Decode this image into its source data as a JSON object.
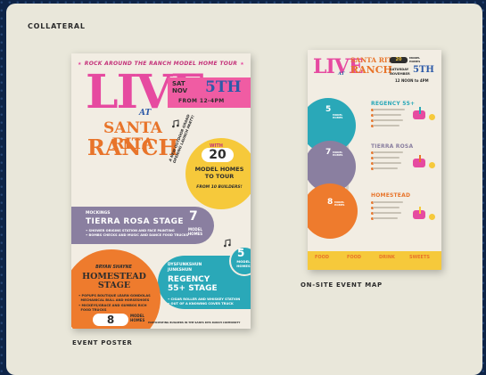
{
  "section_title": "COLLATERAL",
  "poster_caption": "EVENT POSTER",
  "map_caption": "ON-SITE EVENT MAP",
  "poster": {
    "tour_line": "ROCK AROUND THE RANCH MODEL HOME TOUR",
    "live": "LIVE",
    "at": "AT",
    "santa_rita": "SANTA RITA",
    "ranch": "RANCH",
    "sat_nov": "SAT\nNOV",
    "day": "5TH",
    "time": "FROM 12-4PM",
    "vertical_text": "A NEW OUTDOOR GRAND OPENING LAUNCH PARTY!",
    "with": "WITH",
    "model_count": "20",
    "model_homes_line": "MODEL HOMES\nTO TOUR",
    "builders": "FROM 10 BUILDERS!",
    "tierra_rosa_small": "MOCKINGS",
    "tierra_rosa_stage": "TIERRA ROSA STAGE",
    "tierra_rosa_list": "• SHOWER ORIGINS STATION AND FACE PAINTING\n• BOMBS CHECKS AND MUSIC AND DANCE FOOD TRUCKS",
    "tierra_count": "7",
    "tierra_mh": "MODEL HOMES",
    "regency_count": "5",
    "regency_mh": "MODEL HOMES",
    "dj": "DYSFUNKSHUN\nJUNKSHUN",
    "regency_stage": "REGENCY\n55+ STAGE",
    "regency_list": "• CIGAR ROLLER AND WHISKEY STATION\n• OUT OF A KNOWING COVER TRUCK",
    "bryan": "BRYAN SHAYNE",
    "homestead_stage": "HOMESTEAD\nSTAGE",
    "homestead_list": "• POPUPS BOUTIQUE LEARN GONDOLAS\n  MECHANICAL BULL AND HORSESHOES\n• MICKEYS/GRACE AND GUMBOS RICH\n  FOOD TRUCKS",
    "homestead_count": "8",
    "homestead_mh": "MODEL\nHOMES",
    "footer": "PARTICIPATING BUILDERS IN THE SANTA RITA RANCH COMMUNITY"
  },
  "map": {
    "live": "LIVE",
    "at": "AT",
    "santa_rita": "SANTA RITA",
    "ranch": "RANCH",
    "model_count": "20",
    "model_homes": "MODEL\nHOMES",
    "sat": "SATURDAY\nNOVEMBER",
    "day": "5TH",
    "time": "12 NOON to 4PM",
    "regency_count": "5",
    "regency_head": "REGENCY 55+",
    "tierra_count": "7",
    "tierra_head": "TIERRA ROSA",
    "homestead_count": "8",
    "homestead_head": "HOMESTEAD",
    "circle_mh": "MODEL\nHOMES",
    "bottom": [
      "FOOD",
      "FOOD",
      "DRINK",
      "SWEETS"
    ]
  },
  "colors": {
    "pink": "#e64aa0",
    "orange": "#e8742a",
    "yellow": "#f6c93b",
    "purple": "#8a7fa0",
    "teal": "#2aa8b8",
    "blue": "#2d5aa8",
    "cream": "#f2ede3",
    "card": "#e9e7da"
  }
}
